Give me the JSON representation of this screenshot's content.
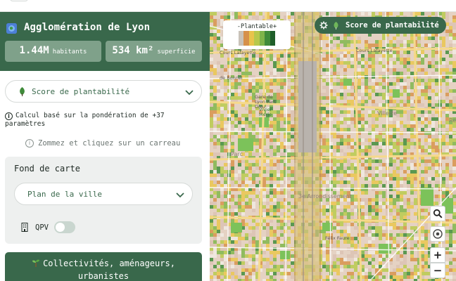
{
  "header": {
    "title": "Agglomération de Lyon",
    "stats": [
      {
        "value": "1.44M",
        "unit": "habitants"
      },
      {
        "value": "534 km²",
        "unit": "superficie"
      }
    ]
  },
  "score_select": {
    "value": "Score de plantabilité",
    "icon": "leaf-icon"
  },
  "info": {
    "text": "Calcul basé sur la pondération de +37 paramètres"
  },
  "hint": {
    "text": "Zommez et cliquez sur un carreau"
  },
  "basemap": {
    "title": "Fond de carte",
    "selected": "Plan de la ville",
    "qpv_label": "QPV",
    "qpv_enabled": false
  },
  "cta": {
    "label": "Collectivités, aménageurs, urbanistes"
  },
  "map": {
    "legend": {
      "title": "-Plantable+",
      "colors": [
        "#c9c2b9",
        "#d6904a",
        "#e9c34b",
        "#b7c84b",
        "#7fb44a",
        "#3f8b3a",
        "#1f5e2a"
      ]
    },
    "layer_pill": {
      "label": "Score de plantabilité"
    },
    "labels": {
      "lafayette": "Cours Lafayette",
      "lafayette2": "Cours Lafayette",
      "bonnel": "de Bonnel",
      "part_dieu": "Gare de\nLyon Part\nDieu",
      "viv": "Vivier\nMerle",
      "arr": "3e Arrondissement",
      "bouquinistes": "Félix Faure",
      "villette": "Villette",
      "re": "Re",
      "parc": "Parc"
    }
  },
  "controls": {
    "zoom_in": "+",
    "zoom_out": "−"
  },
  "colors": {
    "brand_green": "#39684b",
    "stat_bg": "#7fa18a"
  }
}
